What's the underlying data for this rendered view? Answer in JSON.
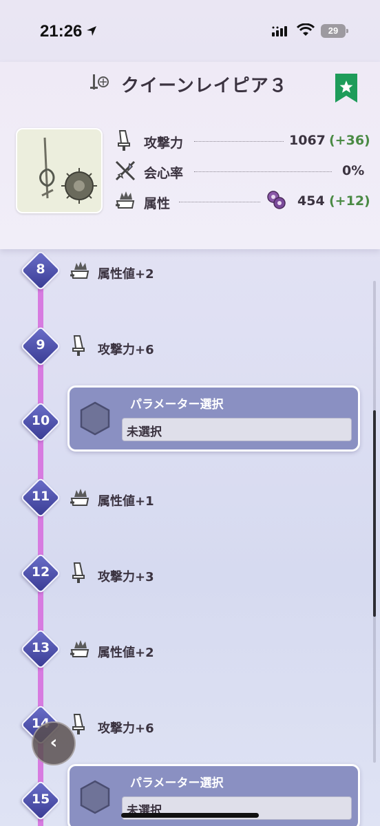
{
  "status_bar": {
    "time": "21:26",
    "battery": "29"
  },
  "header": {
    "weapon_name": "クイーンレイピア３",
    "stats": [
      {
        "label": "攻撃力",
        "value": "1067",
        "bonus": "(+36)"
      },
      {
        "label": "会心率",
        "value": "0%",
        "bonus": ""
      },
      {
        "label": "属性",
        "value": "454",
        "bonus": "(+12)"
      }
    ]
  },
  "timeline": [
    {
      "level": "8",
      "type": "element",
      "label": "属性値+2"
    },
    {
      "level": "9",
      "type": "attack",
      "label": "攻撃力+6"
    },
    {
      "level": "10",
      "type": "param",
      "title": "パラメーター選択",
      "value": "未選択"
    },
    {
      "level": "11",
      "type": "element",
      "label": "属性値+1"
    },
    {
      "level": "12",
      "type": "attack",
      "label": "攻撃力+3"
    },
    {
      "level": "13",
      "type": "element",
      "label": "属性値+2"
    },
    {
      "level": "14",
      "type": "attack",
      "label": "攻撃力+6"
    },
    {
      "level": "15",
      "type": "param",
      "title": "パラメーター選択",
      "value": "未選択"
    }
  ],
  "colors": {
    "accent_green": "#1e9c5a",
    "node_blue": "#3a3c94",
    "timeline_pink": "#d77be0",
    "bonus_green": "#4a8a44"
  }
}
